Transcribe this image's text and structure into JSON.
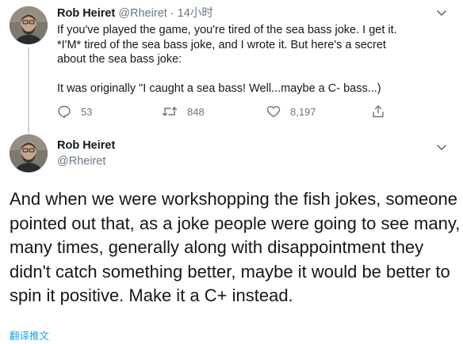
{
  "tweet1": {
    "author_name": "Rob Heiret",
    "author_handle": "@Rheiret",
    "separator": "·",
    "time": "14小时",
    "text_lines": [
      "If you've played the game, you're tired of the sea bass joke. I get it.",
      "*I'M* tired of the sea bass joke, and I wrote it. But here's a secret",
      "about the sea bass joke:",
      "It was originally \"I caught a sea bass! Well...maybe a C- bass...)"
    ],
    "actions": {
      "reply_count": "53",
      "retweet_count": "848",
      "like_count": "8,197"
    }
  },
  "tweet2": {
    "author_name": "Rob Heiret",
    "author_handle": "@Rheiret",
    "text": "And when we were workshopping the fish jokes, someone pointed out that, as a joke people were going to see many, many times, generally along with disappointment they didn't catch something better, maybe it would be better to spin it positive. Make it a C+ instead.",
    "translate_label": "翻译推文"
  },
  "colors": {
    "text_primary": "#14171a",
    "text_secondary": "#657786",
    "link": "#1da1f2",
    "thread_line": "#ccd6dd"
  },
  "icons": {
    "reply": "reply-icon",
    "retweet": "retweet-icon",
    "like": "heart-icon",
    "share": "share-icon",
    "more": "chevron-down-icon"
  }
}
